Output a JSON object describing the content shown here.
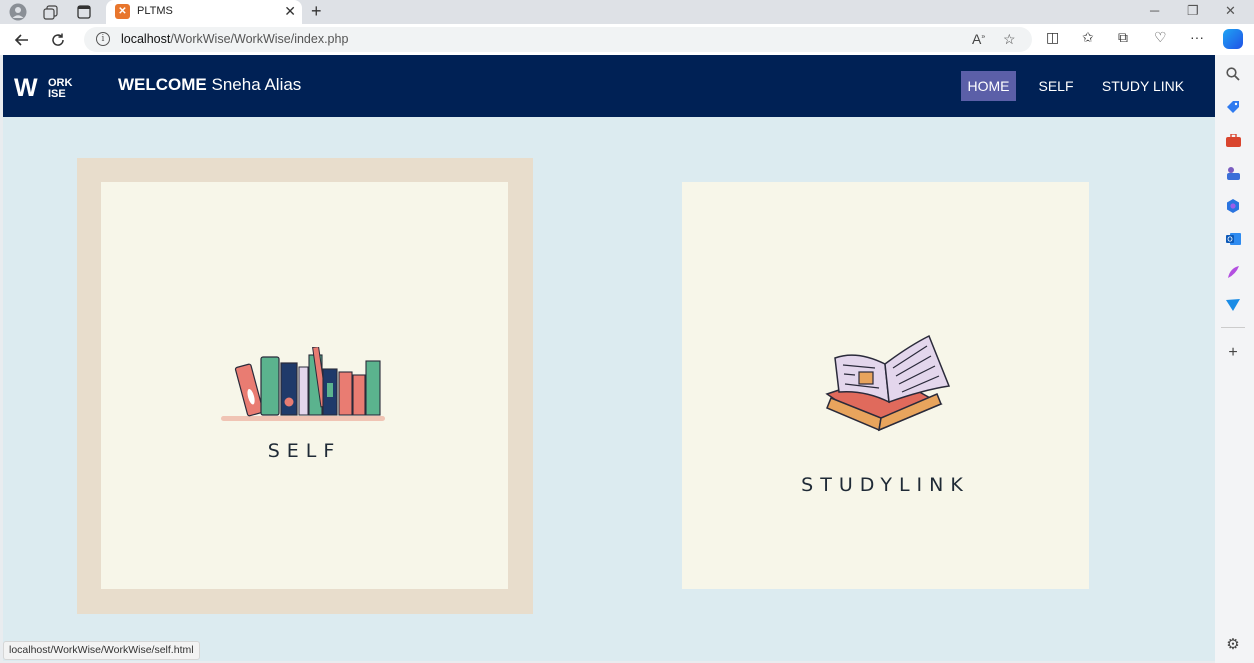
{
  "browser": {
    "tab_title": "PLTMS",
    "tab_favicon": "xampp-icon",
    "url_host": "localhost",
    "url_path": "/WorkWise/WorkWise/index.php",
    "status_url": "localhost/WorkWise/WorkWise/self.html"
  },
  "site": {
    "logo_top": "ORK",
    "logo_w": "W",
    "logo_bottom": "ISE",
    "welcome_prefix": "WELCOME",
    "user_name": "Sneha Alias",
    "nav": [
      {
        "label": "HOME",
        "active": true
      },
      {
        "label": "SELF",
        "active": false
      },
      {
        "label": "STUDY LINK",
        "active": false
      }
    ]
  },
  "cards": [
    {
      "label": "SELF",
      "image": "bookshelf-illustration",
      "hovered": true
    },
    {
      "label": "STUDYLINK",
      "image": "open-book-illustration",
      "hovered": false
    }
  ],
  "colors": {
    "header_bg": "#002155",
    "nav_active": "#5b5fa8",
    "page_bg": "#dcebf0",
    "card_bg": "#f7f6e9",
    "card_hover_frame": "#e8ddcc"
  }
}
